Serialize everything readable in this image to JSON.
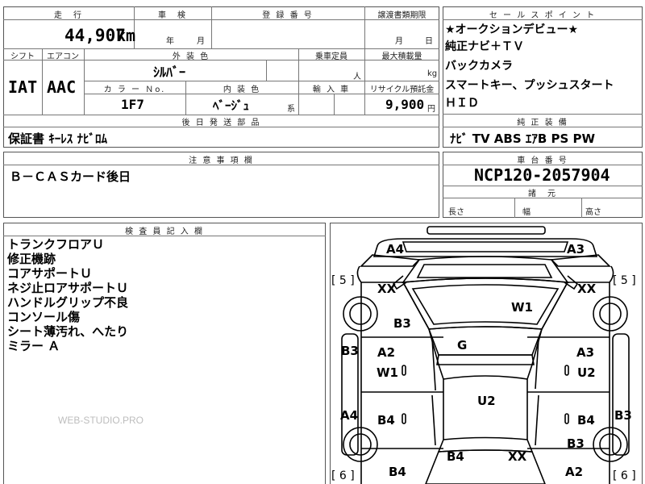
{
  "top": {
    "mileage_label": "走　行",
    "mileage_value": "44,907",
    "mileage_unit": "km",
    "inspection_label": "車　検",
    "inspection_year": "年",
    "inspection_month": "月",
    "registration_label": "登 録 番 号",
    "transfer_label": "譲渡書類期限",
    "transfer_month": "月",
    "transfer_day": "日",
    "shift_label": "シフト",
    "ac_label": "エアコン",
    "exterior_label": "外 装 色",
    "seats_label": "乗車定員",
    "max_load_label": "最大積載量",
    "exterior_value": "ｼﾙﾊﾞｰ",
    "seats_unit": "人",
    "load_unit": "kg",
    "shift_value": "IAT",
    "ac_value": "AAC",
    "color_no_label": "カ ラ ー Ｎo.",
    "interior_label": "内 装 色",
    "import_label": "輸 入 車",
    "recycle_label": "リサイクル預託金",
    "color_no_value": "1F7",
    "interior_value": "ﾍﾞｰｼﾞｭ",
    "interior_suffix": "系",
    "recycle_value": "9,900",
    "recycle_unit": "円",
    "later_label": "後 日 発 送 部 品",
    "later_value": "保証書 ｷｰﾚｽ ﾅﾋﾞﾛﾑ"
  },
  "sales": {
    "label": "セ ー ル ス ポ イ ン ト",
    "points": [
      "★オークションデビュー★",
      "純正ナビ＋ＴＶ",
      "バックカメラ",
      "スマートキー、プッシュスタート",
      "ＨＩＤ"
    ],
    "equip_label": "純 正 装 備",
    "equip_value": "ﾅﾋﾞ  TV  ABS  ｴｱB  PS  PW"
  },
  "caution": {
    "label": "注 意 事 項 欄",
    "value": "Ｂ－ＣＡＳカード後日"
  },
  "chassis": {
    "label": "車 台 番 号",
    "value": "NCP120-2057904",
    "dims_label": "諸　元",
    "length_label": "長さ",
    "width_label": "幅",
    "height_label": "高さ"
  },
  "inspector": {
    "label": "検 査 員 記 入 欄",
    "notes": [
      "トランクフロアＵ",
      "修正機跡",
      "コアサポートＵ",
      "ネジ止ロアサポートＵ",
      "ハンドルグリップ不良",
      "コンソール傷",
      "シート薄汚れ、へたり",
      "ミラー Ａ"
    ],
    "watermark": "WEB-STUDIO.PRO"
  },
  "diagram": {
    "labels": {
      "a4_top": "A4",
      "a3_top": "A3",
      "bracket_tl": "[ 5 ]",
      "bracket_tr": "[ 5 ]",
      "xx_left": "XX",
      "xx_right": "XX",
      "w1_roof": "W1",
      "b3_left_door": "B3",
      "b3_left_side": "B3",
      "a2_left": "A2",
      "g_center": "G",
      "a3_right": "A3",
      "w1_left": "W1",
      "u2_right": "U2",
      "u2_center": "U2",
      "a4_left": "A4",
      "b4_left": "B4",
      "b4_right": "B4",
      "b3_right_side": "B3",
      "b3_right_rear": "B3",
      "b4_rear": "B4",
      "xx_rear": "XX",
      "b4_bottom_left": "B4",
      "a2_bottom_right": "A2",
      "bracket_bl": "[ 6 ]",
      "bracket_br": "[ 6 ]"
    }
  }
}
